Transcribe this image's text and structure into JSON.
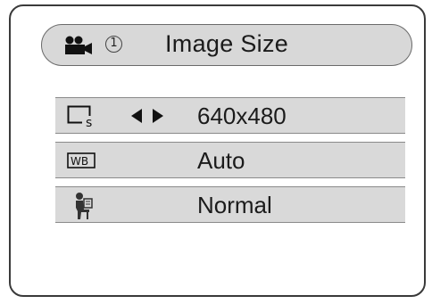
{
  "header": {
    "icon": "camera-icon",
    "step_number": "1",
    "title": "Image Size"
  },
  "rows": [
    {
      "icon": "image-size-icon",
      "value": "640x480",
      "selected": true
    },
    {
      "icon": "white-balance-icon",
      "icon_text": "WB",
      "value": "Auto"
    },
    {
      "icon": "scene-mode-icon",
      "value": "Normal"
    }
  ],
  "colors": {
    "row_background": "#d9d9d9",
    "header_background": "#d8d8d8",
    "text": "#1b1b1b"
  }
}
